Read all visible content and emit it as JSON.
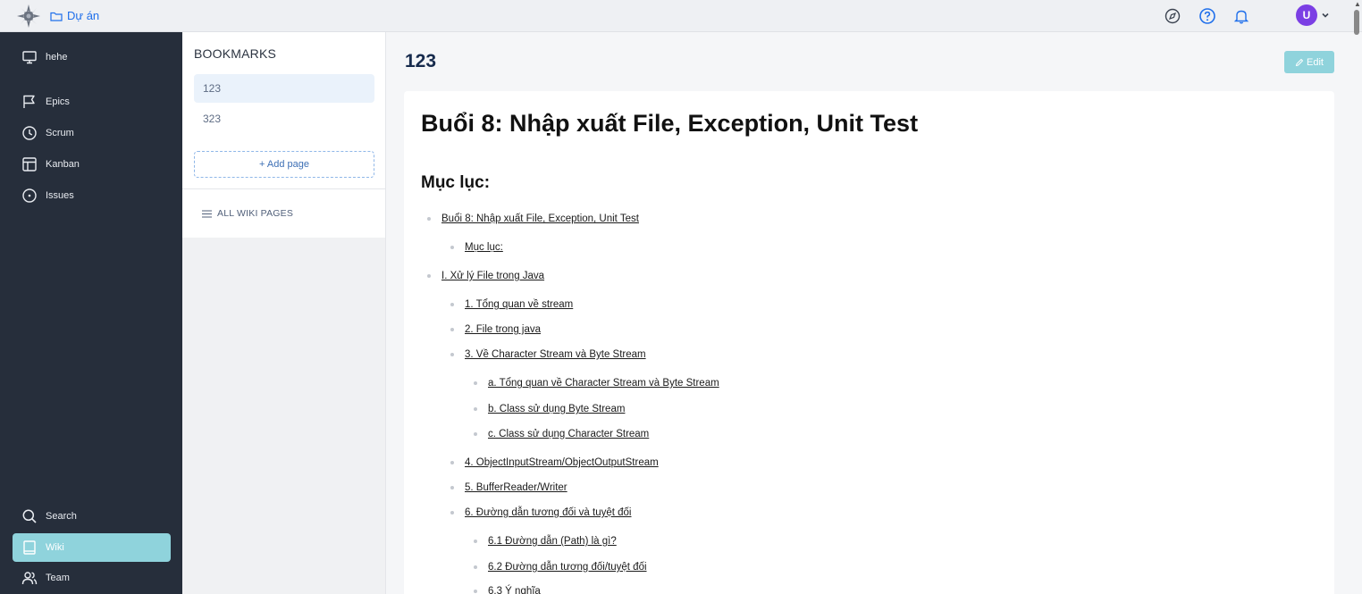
{
  "topbar": {
    "project_label": "Dự án",
    "icons": [
      "compass-icon",
      "help-icon",
      "bell-icon"
    ],
    "avatar_initial": "U",
    "avatar_color": "#7b3fe4"
  },
  "sidebar": {
    "items": [
      {
        "label": "hehe",
        "icon": "monitor-icon"
      },
      {
        "label": "Epics",
        "icon": "flag-icon"
      },
      {
        "label": "Scrum",
        "icon": "clock-icon"
      },
      {
        "label": "Kanban",
        "icon": "board-icon"
      },
      {
        "label": "Issues",
        "icon": "issue-circle-icon"
      },
      {
        "label": "Search",
        "icon": "search-icon"
      },
      {
        "label": "Wiki",
        "icon": "book-icon",
        "active": true
      },
      {
        "label": "Team",
        "icon": "team-icon"
      }
    ],
    "accent": "#8fd3dc"
  },
  "bookmarks": {
    "title": "BOOKMARKS",
    "items": [
      {
        "label": "123",
        "active": true
      },
      {
        "label": "323"
      }
    ],
    "add_page": "+ Add page",
    "all_wiki": "ALL WIKI PAGES"
  },
  "main": {
    "heading": "123",
    "edit_label": "Edit",
    "doc_title": "Buổi 8: Nhập xuất File, Exception, Unit Test",
    "toc_heading": "Mục lục:",
    "toc": [
      {
        "text": "Buổi 8: Nhập xuất File, Exception, Unit Test",
        "level": 1
      },
      {
        "text": "Mục lục:",
        "level": 2
      },
      {
        "text": "I. Xử lý File trong Java",
        "level": 1
      },
      {
        "text": "1. Tổng quan về stream",
        "level": 2
      },
      {
        "text": "2. File trong java",
        "level": 2
      },
      {
        "text": "3. Về Character Stream và Byte Stream",
        "level": 2
      },
      {
        "text": "a. Tổng quan về Character Stream và Byte Stream",
        "level": 3
      },
      {
        "text": "b. Class sử dụng Byte Stream",
        "level": 3
      },
      {
        "text": "c. Class sử dụng Character Stream",
        "level": 3
      },
      {
        "text": "4. ObjectInputStream/ObjectOutputStream",
        "level": 2
      },
      {
        "text": "5. BufferReader/Writer",
        "level": 2
      },
      {
        "text": "6. Đường dẫn tương đối và tuyệt đối",
        "level": 2
      },
      {
        "text": "6.1 Đường dẫn (Path) là gì?",
        "level": 3
      },
      {
        "text": "6.2 Đường dẫn tương đối/tuyệt đối",
        "level": 3
      },
      {
        "text": "6.3 Ý nghĩa",
        "level": 3
      }
    ]
  }
}
